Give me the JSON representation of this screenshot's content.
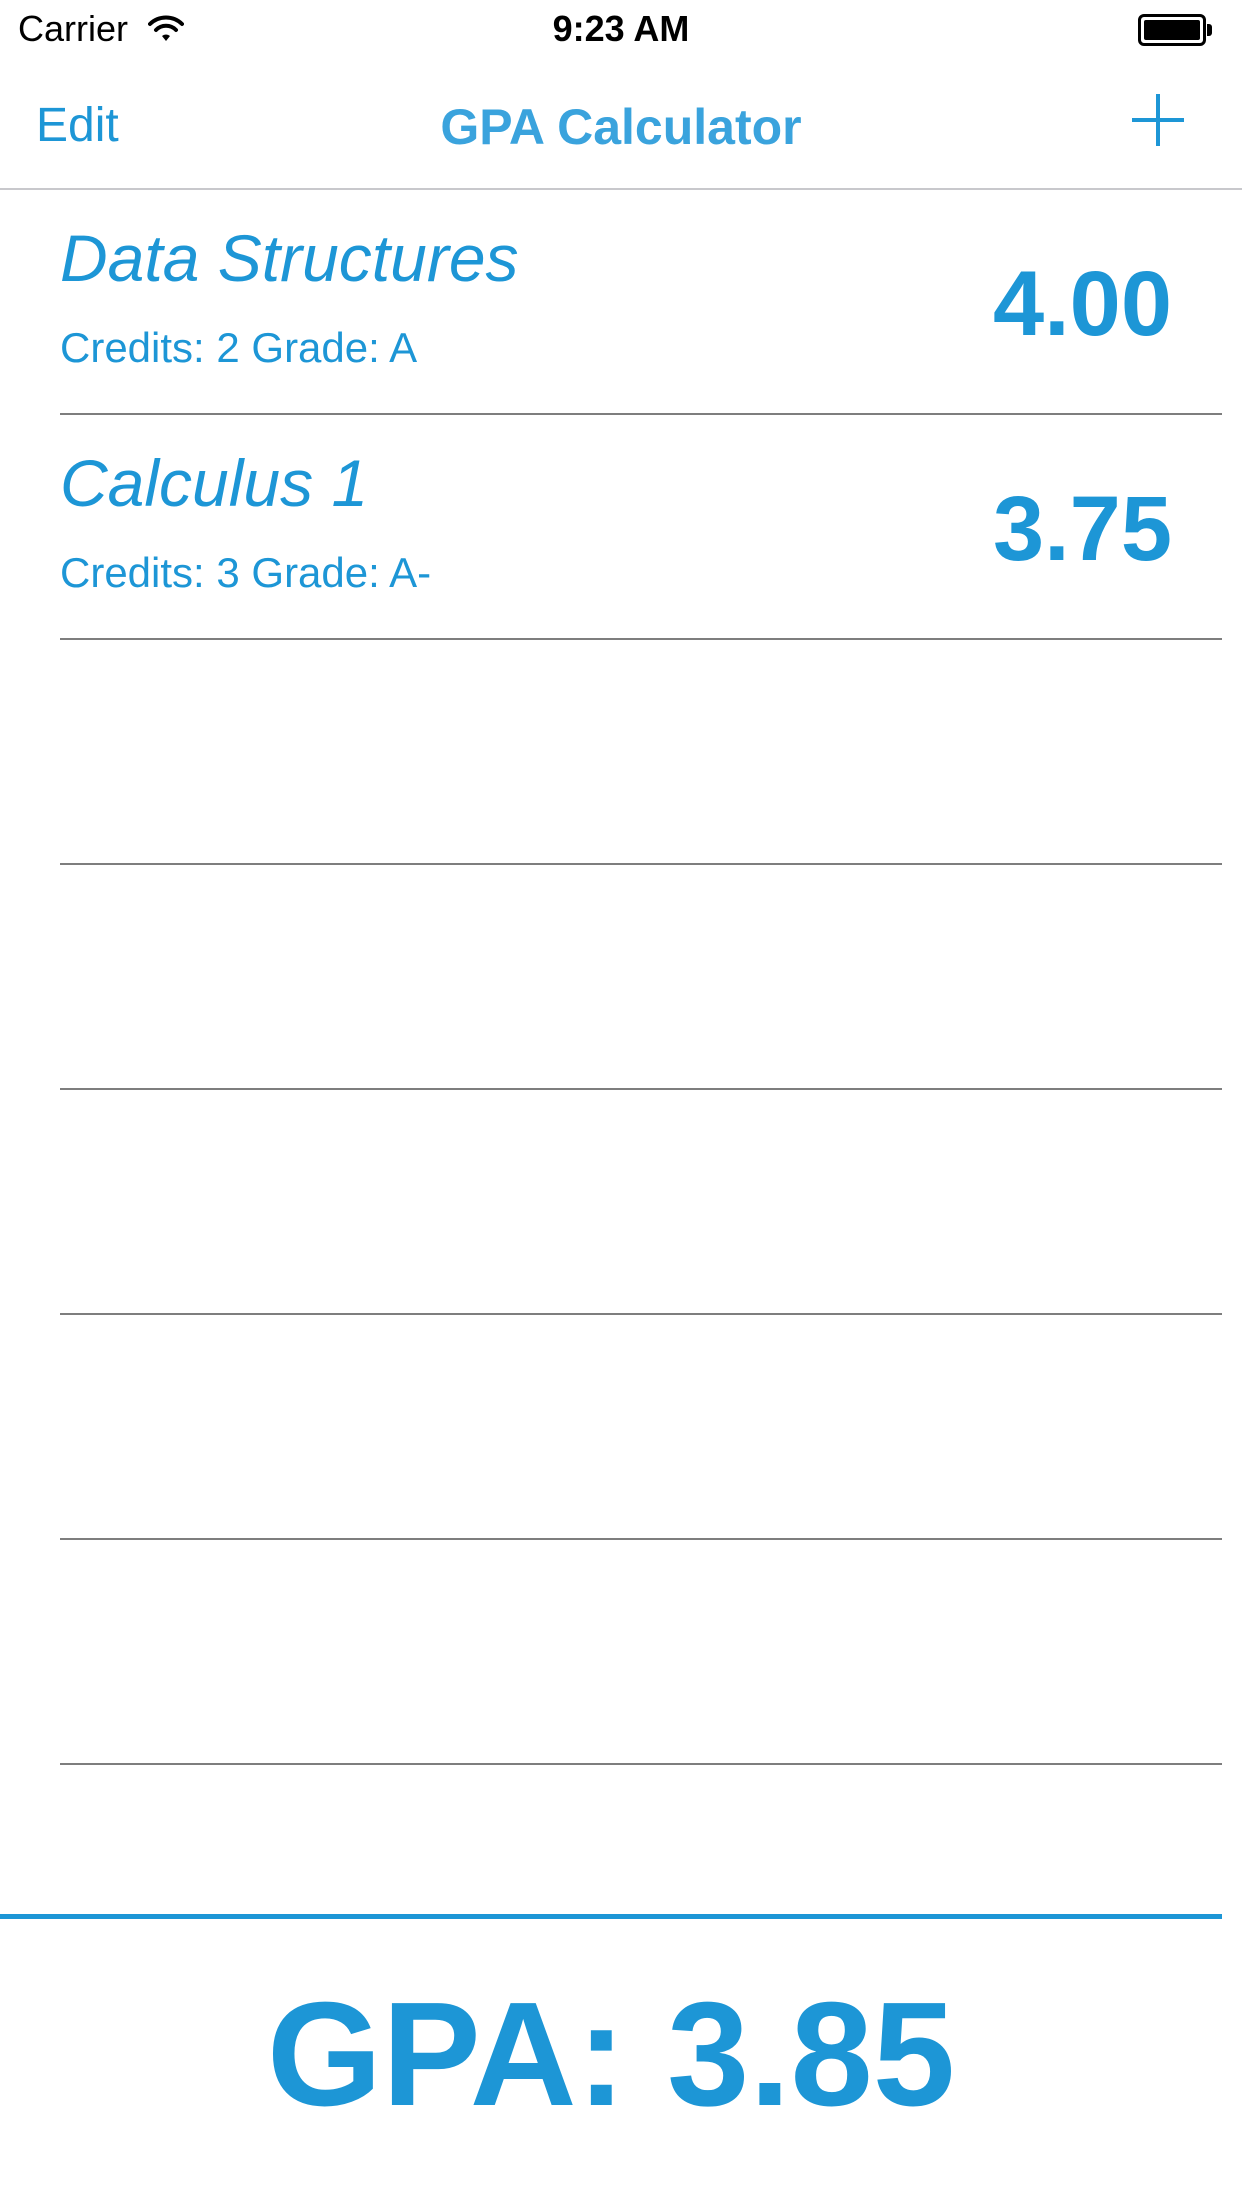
{
  "status_bar": {
    "carrier": "Carrier",
    "time": "9:23 AM"
  },
  "nav": {
    "edit_label": "Edit",
    "title": "GPA Calculator",
    "add_icon": "plus-icon"
  },
  "courses": [
    {
      "name": "Data Structures",
      "detail": "Credits: 2 Grade: A",
      "points": "4.00"
    },
    {
      "name": "Calculus 1",
      "detail": "Credits: 3 Grade: A-",
      "points": "3.75"
    }
  ],
  "empty_rows": 5,
  "gpa": {
    "label": "GPA: 3.85"
  },
  "colors": {
    "accent": "#1d96d6",
    "separator": "#7e7e7e"
  }
}
